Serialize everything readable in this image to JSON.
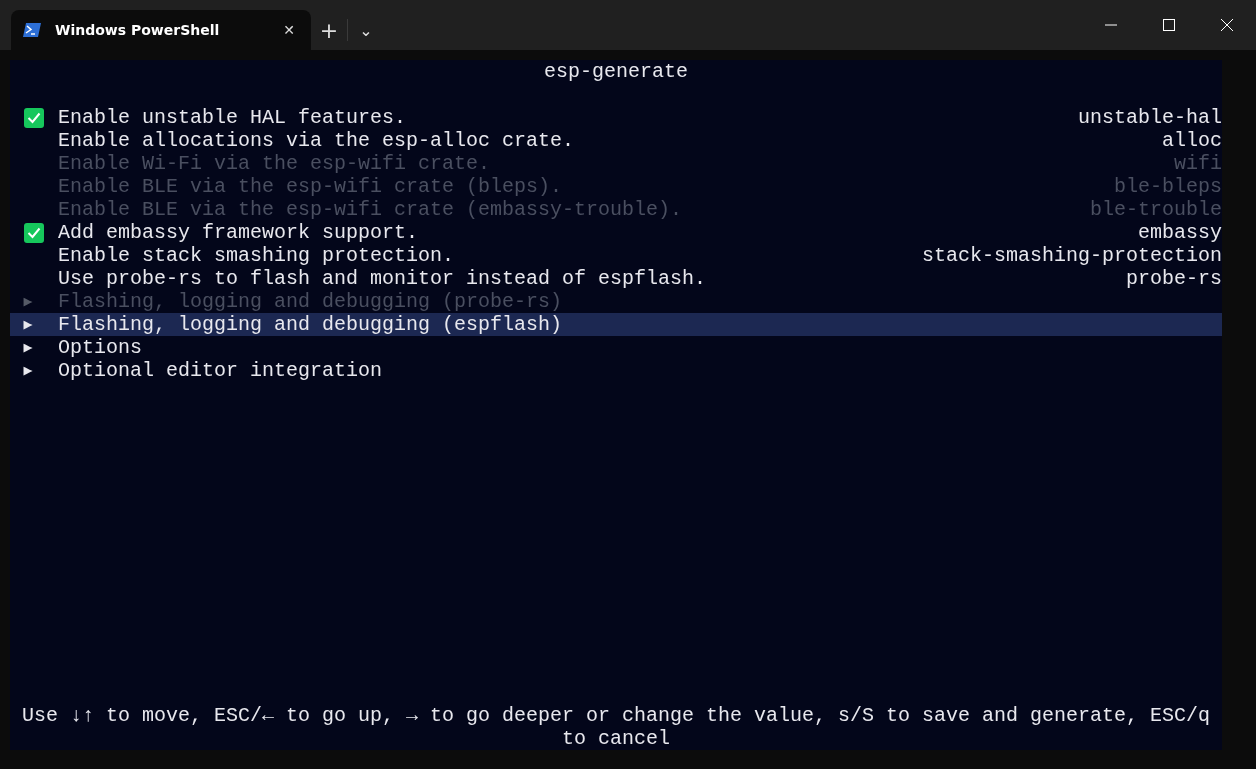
{
  "window": {
    "tab": {
      "title": "Windows PowerShell",
      "close": "✕"
    },
    "new_tab": "+",
    "dropdown": "⌄"
  },
  "terminal": {
    "title": "esp-generate",
    "items": [
      {
        "kind": "option",
        "label": "Enable unstable HAL features.",
        "key": "unstable-hal",
        "checked": true,
        "disabled": false,
        "selected": false
      },
      {
        "kind": "option",
        "label": "Enable allocations via the esp-alloc crate.",
        "key": "alloc",
        "checked": false,
        "disabled": false,
        "selected": false
      },
      {
        "kind": "option",
        "label": "Enable Wi-Fi via the esp-wifi crate.",
        "key": "wifi",
        "checked": false,
        "disabled": true,
        "selected": false
      },
      {
        "kind": "option",
        "label": "Enable BLE via the esp-wifi crate (bleps).",
        "key": "ble-bleps",
        "checked": false,
        "disabled": true,
        "selected": false
      },
      {
        "kind": "option",
        "label": "Enable BLE via the esp-wifi crate (embassy-trouble).",
        "key": "ble-trouble",
        "checked": false,
        "disabled": true,
        "selected": false
      },
      {
        "kind": "option",
        "label": "Add embassy framework support.",
        "key": "embassy",
        "checked": true,
        "disabled": false,
        "selected": false
      },
      {
        "kind": "option",
        "label": "Enable stack smashing protection.",
        "key": "stack-smashing-protection",
        "checked": false,
        "disabled": false,
        "selected": false
      },
      {
        "kind": "option",
        "label": "Use probe-rs to flash and monitor instead of espflash.",
        "key": "probe-rs",
        "checked": false,
        "disabled": false,
        "selected": false
      },
      {
        "kind": "menu",
        "marker": "▶",
        "label": "Flashing, logging and debugging (probe-rs)",
        "disabled": true,
        "selected": false
      },
      {
        "kind": "menu",
        "marker": "▶",
        "label": "Flashing, logging and debugging (espflash)",
        "disabled": false,
        "selected": true
      },
      {
        "kind": "menu",
        "marker": "▶",
        "label": "Options",
        "disabled": false,
        "selected": false
      },
      {
        "kind": "menu",
        "marker": "▶",
        "label": "Optional editor integration",
        "disabled": false,
        "selected": false
      }
    ],
    "help": "Use ↓↑ to move, ESC/← to go up, → to go deeper or change the value, s/S to save and generate, ESC/q to cancel"
  }
}
